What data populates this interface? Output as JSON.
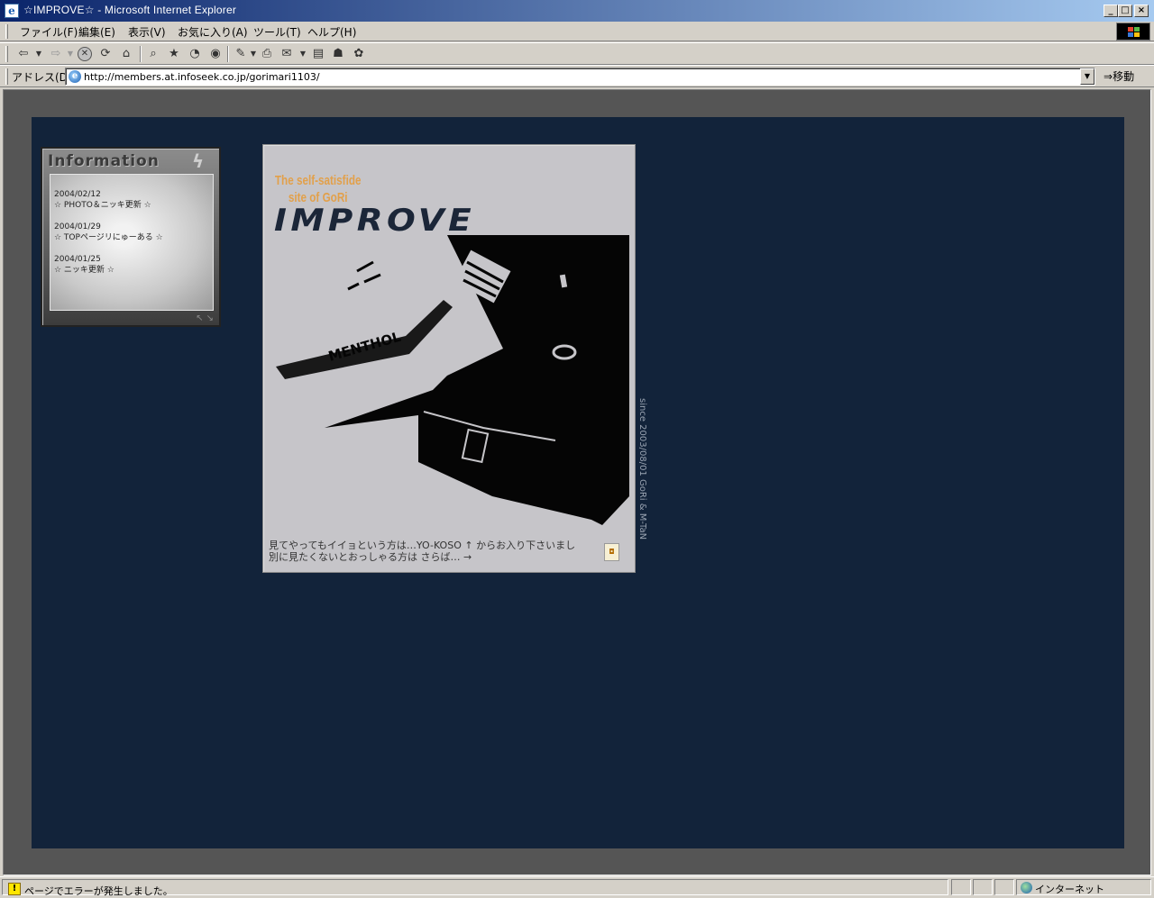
{
  "window": {
    "title": "☆IMPROVE☆ - Microsoft Internet Explorer",
    "icon": "ie-icon",
    "minimize": "_",
    "maximize": "□",
    "close": "×"
  },
  "menu": {
    "items": [
      "ファイル(F)",
      "編集(E)",
      "表示(V)",
      "お気に入り(A)",
      "ツール(T)",
      "ヘルプ(H)"
    ]
  },
  "toolbar": {
    "icons": [
      "back-icon",
      "forward-icon",
      "stop-icon",
      "refresh-icon",
      "home-icon",
      "search-icon",
      "favorites-icon",
      "history-icon",
      "media-icon",
      "edit-icon",
      "print-icon",
      "mail-icon",
      "discuss-icon",
      "messenger-icon"
    ]
  },
  "address": {
    "label": "アドレス(D)",
    "url": "http://members.at.infoseek.co.jp/gorimari1103/",
    "go_label": "移動"
  },
  "page": {
    "info": {
      "title": "Information",
      "entries": [
        {
          "date": "2004/02/12",
          "text": "☆ PHOTO＆ニッキ更新 ☆"
        },
        {
          "date": "2004/01/29",
          "text": "☆ TOPページリにゅーある ☆"
        },
        {
          "date": "2004/01/25",
          "text": "☆ ニッキ更新 ☆"
        }
      ]
    },
    "main": {
      "tagline": "The self-satisfide site of GoRi",
      "logo": "IMPROVE",
      "photo_text": "MENTHOL",
      "greeting_line1": "見てやってもイイョという方は…YO-KOSO ↑ からお入り下さいまし",
      "greeting_line2": "別に見たくないとおっしゃる方は さらば… →"
    },
    "since": "since 2003/08/01 GoRi & M-TaN"
  },
  "status": {
    "message": "ページでエラーが発生しました。",
    "zone": "インターネット"
  },
  "colors": {
    "titlebar_start": "#0a246a",
    "page_background": "#12233a",
    "frame_background": "#555555",
    "tagline": "#e2a04a"
  }
}
